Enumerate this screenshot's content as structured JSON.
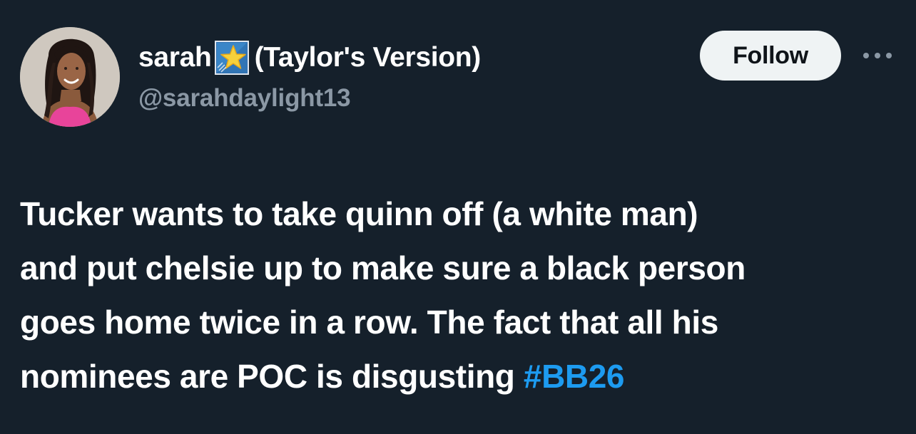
{
  "tweet": {
    "author": {
      "name_before_emoji": "sarah",
      "emoji": "star-emoji",
      "name_after_emoji": "(Taylor's Version)",
      "handle": "@sarahdaylight13",
      "avatar": "profile-photo"
    },
    "follow_label": "Follow",
    "more_icon": "ellipsis-icon",
    "text_lines": [
      "Tucker wants to take quinn off (a white  man)",
      "and put chelsie up to make sure a black person",
      "goes home twice in a row. The fact that all his",
      "nominees are POC is disgusting "
    ],
    "hashtag": "#BB26"
  },
  "colors": {
    "background": "#15202b",
    "text": "#ffffff",
    "secondary_text": "#8b98a5",
    "link": "#1d9bf0",
    "follow_button_bg": "#eff3f4",
    "follow_button_text": "#0f1419"
  }
}
